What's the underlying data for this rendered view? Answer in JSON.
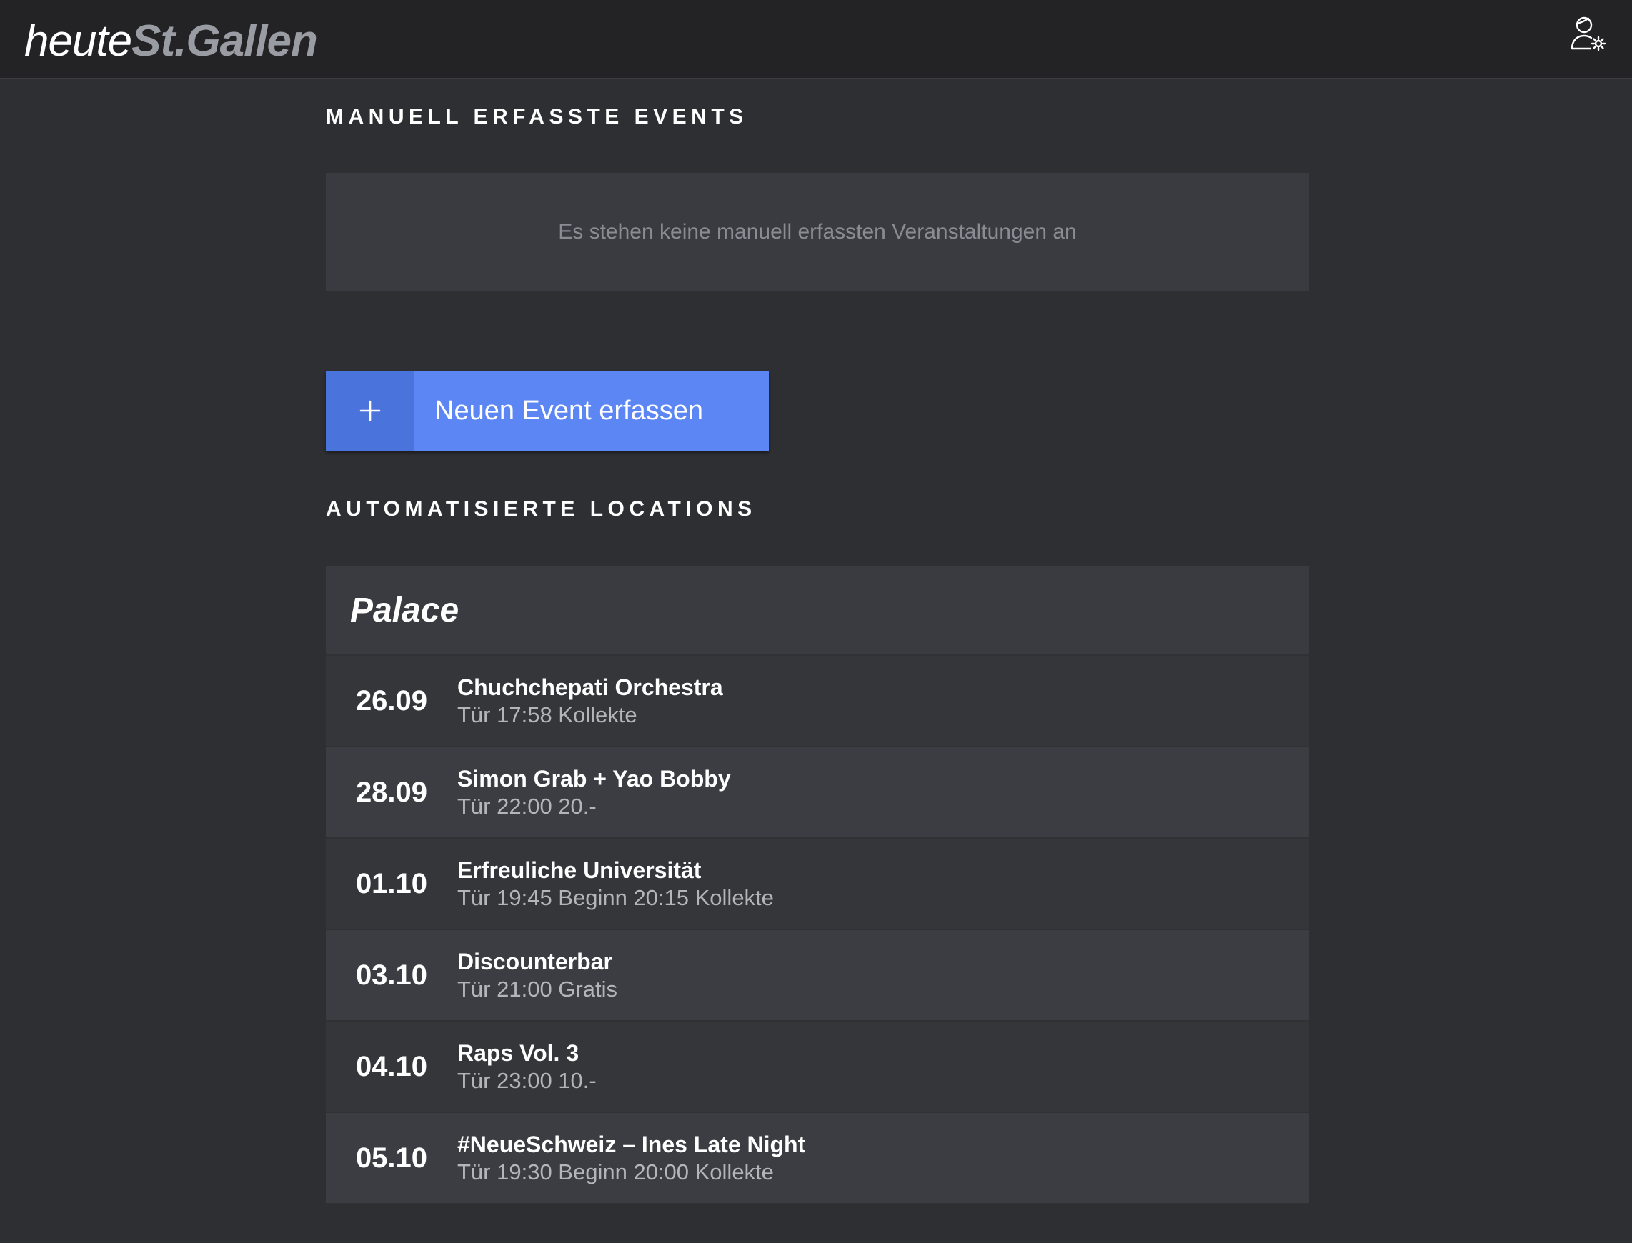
{
  "header": {
    "logo_light": "heute",
    "logo_bold": "St.Gallen"
  },
  "manual": {
    "heading": "MANUELL ERFASSTE EVENTS",
    "empty_message": "Es stehen keine manuell erfassten Veranstaltungen an",
    "new_event_button": "Neuen Event erfassen"
  },
  "automated": {
    "heading": "AUTOMATISIERTE LOCATIONS",
    "location": {
      "name": "Palace",
      "events": [
        {
          "date": "26.09",
          "title": "Chuchchepati Orchestra",
          "details": "Tür 17:58 Kollekte"
        },
        {
          "date": "28.09",
          "title": "Simon Grab + Yao Bobby",
          "details": "Tür 22:00 20.-"
        },
        {
          "date": "01.10",
          "title": "Erfreuliche Universität",
          "details": "Tür 19:45 Beginn 20:15 Kollekte"
        },
        {
          "date": "03.10",
          "title": "Discounterbar",
          "details": "Tür 21:00 Gratis"
        },
        {
          "date": "04.10",
          "title": "Raps Vol. 3",
          "details": "Tür 23:00 10.-"
        },
        {
          "date": "05.10",
          "title": "#NeueSchweiz – Ines Late Night",
          "details": "Tür 19:30 Beginn 20:00 Kollekte"
        }
      ]
    }
  },
  "icons": {
    "user_settings": "user-settings-icon",
    "plus": "plus-icon"
  },
  "colors": {
    "background": "#2e2f33",
    "topbar": "#232325",
    "panel": "#3a3b40",
    "accent": "#5b86f3",
    "accent_dark": "#4a73db"
  }
}
